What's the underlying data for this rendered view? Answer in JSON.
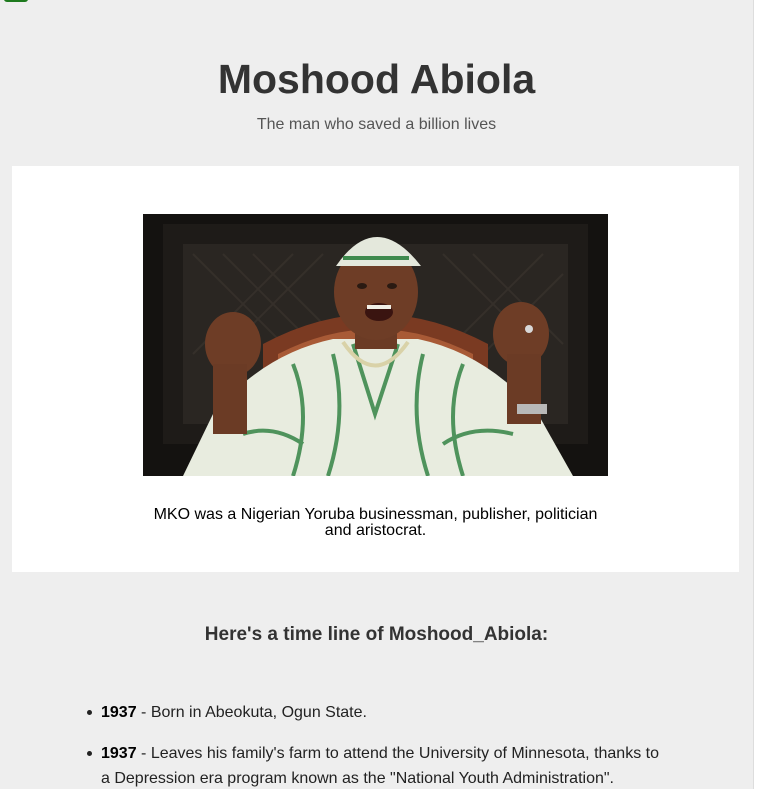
{
  "header": {
    "title": "Moshood Abiola",
    "subtitle": "The man who saved a billion lives"
  },
  "card": {
    "image_alt": "Portrait of Moshood Abiola",
    "caption": "MKO was a Nigerian Yoruba businessman, publisher, politician and aristocrat."
  },
  "timeline": {
    "heading": "Here's a time line of Moshood_Abiola:",
    "items": [
      {
        "year": "1937",
        "text": " - Born in Abeokuta, Ogun State."
      },
      {
        "year": "1937",
        "text": " - Leaves his family's farm to attend the University of Minnesota, thanks to a Depression era program known as the \"National Youth Administration\"."
      }
    ]
  },
  "colors": {
    "page_bg": "#eeeeee",
    "card_bg": "#ffffff",
    "title_text": "#333333",
    "corner_mark": "#1e7a1e"
  }
}
